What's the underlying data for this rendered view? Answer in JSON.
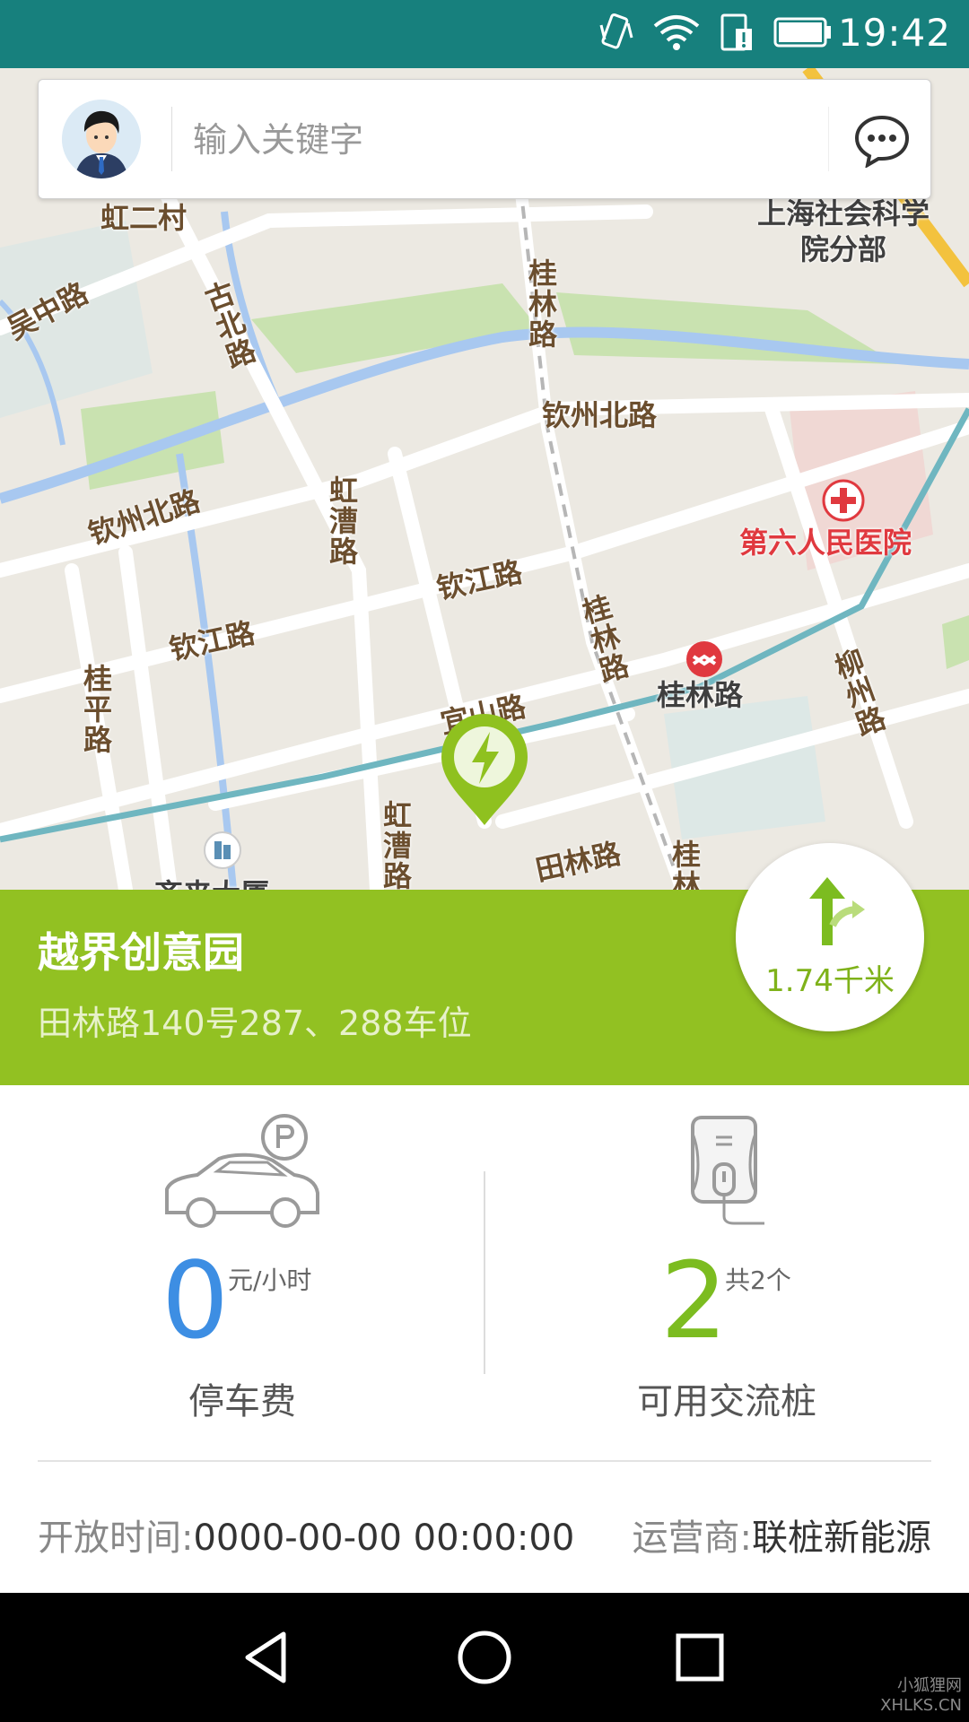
{
  "status_bar": {
    "time": "19:42"
  },
  "search": {
    "placeholder": "输入关键字"
  },
  "map": {
    "labels": {
      "hongercun": "虹二村",
      "shanghai_academy": "上海社会科学院分部",
      "wuzhong_rd": "吴中路",
      "gubei_rd": "古北路",
      "guilin_rd_north": "桂林路",
      "qinzhou_north_rd_right": "钦州北路",
      "qinzhou_north_rd_left": "钦州北路",
      "hongcao_rd": "虹漕路",
      "qinjiang_rd_center": "钦江路",
      "qinjiang_rd_left": "钦江路",
      "guiping_rd": "桂平路",
      "guilin_rd_mid": "桂林路",
      "hospital": "第六人民医院",
      "metro_station": "桂林路",
      "liuzhou_rd": "柳州路",
      "yishan_rd": "宜山路",
      "hongcao_rd_south": "虹漕路",
      "tianlin_rd": "田林路",
      "guilin_rd_south": "桂林",
      "building": "齐来大厦"
    }
  },
  "station": {
    "name": "越界创意园",
    "address": "田林路140号287、288车位",
    "distance": "1.74千米"
  },
  "parking": {
    "value": "0",
    "unit": "元/小时",
    "label": "停车费",
    "value_color": "#3d8ee3"
  },
  "chargers": {
    "value": "2",
    "unit": "共2个",
    "label": "可用交流桩",
    "value_color": "#7cbc20"
  },
  "footer": {
    "open_time_label": "开放时间:",
    "open_time_value": "0000-00-00 00:00:00",
    "operator_label": "运营商:",
    "operator_value": "联桩新能源"
  },
  "watermark": {
    "line1": "小狐狸网",
    "line2": "XHLKS.CN"
  },
  "colors": {
    "status_bar": "#17807d",
    "panel_green": "#92c122",
    "accent_green": "#7cbc20",
    "accent_blue": "#3d8ee3"
  }
}
